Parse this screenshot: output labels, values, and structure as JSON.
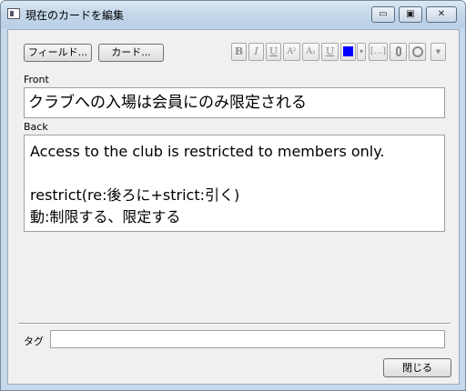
{
  "window": {
    "title": "現在のカードを編集"
  },
  "toolbar": {
    "fields_button": "フィールド...",
    "cards_button": "カード...",
    "format_buttons": [
      "B",
      "I",
      "U",
      "A²",
      "A₂",
      "U",
      "▾",
      "[...]"
    ]
  },
  "colors": {
    "text_color_swatch": "#0000ff"
  },
  "front": {
    "label": "Front",
    "value": "クラブへの入場は会員にのみ限定される"
  },
  "back": {
    "label": "Back",
    "line1": "Access to the club is restricted to members only.",
    "line2": "restrict(re:後ろに+strict:引く)",
    "line3": "動:制限する、限定する"
  },
  "tags": {
    "label": "タグ",
    "value": ""
  },
  "close_button": "閉じる"
}
